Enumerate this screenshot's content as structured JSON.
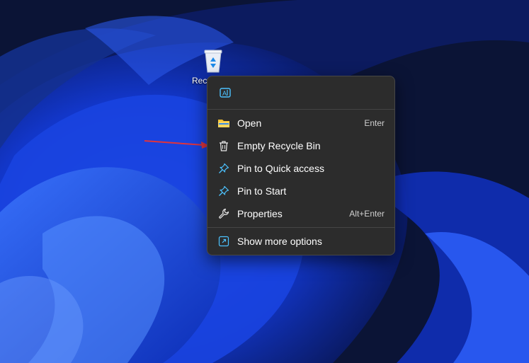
{
  "desktop": {
    "recycle_bin_label": "Recycle Bin"
  },
  "context_menu": {
    "quick_actions": [
      {
        "icon": "translate-icon"
      }
    ],
    "items": [
      {
        "label": "Open",
        "shortcut": "Enter",
        "icon": "folder-icon"
      },
      {
        "label": "Empty Recycle Bin",
        "shortcut": "",
        "icon": "trash-icon"
      },
      {
        "label": "Pin to Quick access",
        "shortcut": "",
        "icon": "pin-icon"
      },
      {
        "label": "Pin to Start",
        "shortcut": "",
        "icon": "pin-icon"
      },
      {
        "label": "Properties",
        "shortcut": "Alt+Enter",
        "icon": "wrench-icon"
      }
    ],
    "show_more": {
      "label": "Show more options",
      "icon": "expand-icon"
    }
  },
  "colors": {
    "menu_bg": "#2c2c2c",
    "menu_border": "#474747",
    "accent": "#4cc2ff",
    "annotation_arrow": "#e0343c",
    "folder_yellow": "#f8c331"
  }
}
